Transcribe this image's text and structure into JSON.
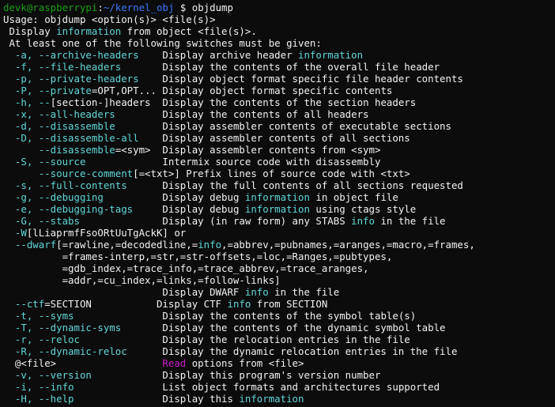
{
  "terminal": {
    "colors": {
      "background": "#0c0c0c",
      "default": "#f2f2f2",
      "prompt_user": "#13a10e",
      "prompt_path": "#3b78ff",
      "accent": "#61d6d6",
      "highlight": "#c81ec8"
    },
    "lines": [
      {
        "segments": [
          {
            "text": "devk@raspberrypi",
            "color": "prompt-user"
          },
          {
            "text": ":",
            "color": "default"
          },
          {
            "text": "~/kernel_obj",
            "color": "prompt-path"
          },
          {
            "text": " $ objdump",
            "color": "default"
          }
        ]
      },
      {
        "segments": [
          {
            "text": "Usage: objdump <option(s)> <file(s)>",
            "color": "default"
          }
        ]
      },
      {
        "segments": [
          {
            "text": " Display ",
            "color": "default"
          },
          {
            "text": "information",
            "color": "accent"
          },
          {
            "text": " from object <file(s)>.",
            "color": "default"
          }
        ]
      },
      {
        "segments": [
          {
            "text": " At least one of the following switches must be given:",
            "color": "default"
          }
        ]
      },
      {
        "segments": [
          {
            "text": "  -a, --archive-headers",
            "color": "accent"
          },
          {
            "text": "    Display archive header ",
            "color": "default"
          },
          {
            "text": "information",
            "color": "accent"
          }
        ]
      },
      {
        "segments": [
          {
            "text": "  -f, --file-headers",
            "color": "accent"
          },
          {
            "text": "       Display the contents of the overall file header",
            "color": "default"
          }
        ]
      },
      {
        "segments": [
          {
            "text": "  -p, --private-headers",
            "color": "accent"
          },
          {
            "text": "    Display object format specific file header contents",
            "color": "default"
          }
        ]
      },
      {
        "segments": [
          {
            "text": "  -P, --private",
            "color": "accent"
          },
          {
            "text": "=OPT,OPT...",
            "color": "default"
          },
          {
            "text": " Display object format specific contents",
            "color": "default"
          }
        ]
      },
      {
        "segments": [
          {
            "text": "  -h, --",
            "color": "accent"
          },
          {
            "text": "[section-]headers",
            "color": "default"
          },
          {
            "text": "  Display the contents of the section headers",
            "color": "default"
          }
        ]
      },
      {
        "segments": [
          {
            "text": "  -x, --all-headers",
            "color": "accent"
          },
          {
            "text": "        Display the contents of all headers",
            "color": "default"
          }
        ]
      },
      {
        "segments": [
          {
            "text": "  -d, --disassemble",
            "color": "accent"
          },
          {
            "text": "        Display assembler contents of executable sections",
            "color": "default"
          }
        ]
      },
      {
        "segments": [
          {
            "text": "  -D, --disassemble-all",
            "color": "accent"
          },
          {
            "text": "    Display assembler contents of all sections",
            "color": "default"
          }
        ]
      },
      {
        "segments": [
          {
            "text": "      --disassemble",
            "color": "accent"
          },
          {
            "text": "=<sym>  Display assembler contents from <sym>",
            "color": "default"
          }
        ]
      },
      {
        "segments": [
          {
            "text": "  -S, --source",
            "color": "accent"
          },
          {
            "text": "             Intermix source code with disassembly",
            "color": "default"
          }
        ]
      },
      {
        "segments": [
          {
            "text": "      --source-comment",
            "color": "accent"
          },
          {
            "text": "[=<txt>] Prefix lines of source code with <txt>",
            "color": "default"
          }
        ]
      },
      {
        "segments": [
          {
            "text": "  -s, --full-contents",
            "color": "accent"
          },
          {
            "text": "      Display the full contents of all sections requested",
            "color": "default"
          }
        ]
      },
      {
        "segments": [
          {
            "text": "  -g, --debugging",
            "color": "accent"
          },
          {
            "text": "          Display debug ",
            "color": "default"
          },
          {
            "text": "information",
            "color": "accent"
          },
          {
            "text": " in object file",
            "color": "default"
          }
        ]
      },
      {
        "segments": [
          {
            "text": "  -e, --debugging-tags",
            "color": "accent"
          },
          {
            "text": "     Display debug ",
            "color": "default"
          },
          {
            "text": "information",
            "color": "accent"
          },
          {
            "text": " using ctags style",
            "color": "default"
          }
        ]
      },
      {
        "segments": [
          {
            "text": "  -G, --stabs",
            "color": "accent"
          },
          {
            "text": "              Display (in raw form) any STABS ",
            "color": "default"
          },
          {
            "text": "info",
            "color": "accent"
          },
          {
            "text": " in the file",
            "color": "default"
          }
        ]
      },
      {
        "segments": [
          {
            "text": "  -W",
            "color": "accent"
          },
          {
            "text": "[lLiaprmfFsoORtUuTgAckK] or",
            "color": "default"
          }
        ]
      },
      {
        "segments": [
          {
            "text": "  --dwarf",
            "color": "accent"
          },
          {
            "text": "[=rawline,=decodedline,=",
            "color": "default"
          },
          {
            "text": "info",
            "color": "accent"
          },
          {
            "text": ",=abbrev,=pubnames,=aranges,=macro,=frames,",
            "color": "default"
          }
        ]
      },
      {
        "segments": [
          {
            "text": "          =frames-interp,=str,=str-offsets,=loc,=Ranges,=pubtypes,",
            "color": "default"
          }
        ]
      },
      {
        "segments": [
          {
            "text": "          =gdb_index,=trace_info,=trace_abbrev,=trace_aranges,",
            "color": "default"
          }
        ]
      },
      {
        "segments": [
          {
            "text": "          =addr,=cu_index,=links,=follow-links]",
            "color": "default"
          }
        ]
      },
      {
        "segments": [
          {
            "text": "                           Display DWARF ",
            "color": "default"
          },
          {
            "text": "info",
            "color": "accent"
          },
          {
            "text": " in the file",
            "color": "default"
          }
        ]
      },
      {
        "segments": [
          {
            "text": "  --ctf",
            "color": "accent"
          },
          {
            "text": "=SECTION",
            "color": "default"
          },
          {
            "text": "           Display CTF ",
            "color": "default"
          },
          {
            "text": "info",
            "color": "accent"
          },
          {
            "text": " from SECTION",
            "color": "default"
          }
        ]
      },
      {
        "segments": [
          {
            "text": "  -t, --syms",
            "color": "accent"
          },
          {
            "text": "               Display the contents of the symbol table(s)",
            "color": "default"
          }
        ]
      },
      {
        "segments": [
          {
            "text": "  -T, --dynamic-syms",
            "color": "accent"
          },
          {
            "text": "       Display the contents of the dynamic symbol table",
            "color": "default"
          }
        ]
      },
      {
        "segments": [
          {
            "text": "  -r, --reloc",
            "color": "accent"
          },
          {
            "text": "              Display the relocation entries in the file",
            "color": "default"
          }
        ]
      },
      {
        "segments": [
          {
            "text": "  -R, --dynamic-reloc",
            "color": "accent"
          },
          {
            "text": "      Display the dynamic relocation entries in the file",
            "color": "default"
          }
        ]
      },
      {
        "segments": [
          {
            "text": "  @<file>",
            "color": "default"
          },
          {
            "text": "                  ",
            "color": "default"
          },
          {
            "text": "Read",
            "color": "highlight"
          },
          {
            "text": " options from <file>",
            "color": "default"
          }
        ]
      },
      {
        "segments": [
          {
            "text": "  -v, --version",
            "color": "accent"
          },
          {
            "text": "            Display this program's version number",
            "color": "default"
          }
        ]
      },
      {
        "segments": [
          {
            "text": "  -i, --info",
            "color": "accent"
          },
          {
            "text": "               List object formats and architectures supported",
            "color": "default"
          }
        ]
      },
      {
        "segments": [
          {
            "text": "  -H, --help",
            "color": "accent"
          },
          {
            "text": "               Display this ",
            "color": "default"
          },
          {
            "text": "information",
            "color": "accent"
          }
        ]
      },
      {
        "segments": [
          {
            "text": "  ",
            "color": "default"
          },
          {
            "text": "                                 ",
            "color": "dim"
          }
        ]
      }
    ]
  }
}
